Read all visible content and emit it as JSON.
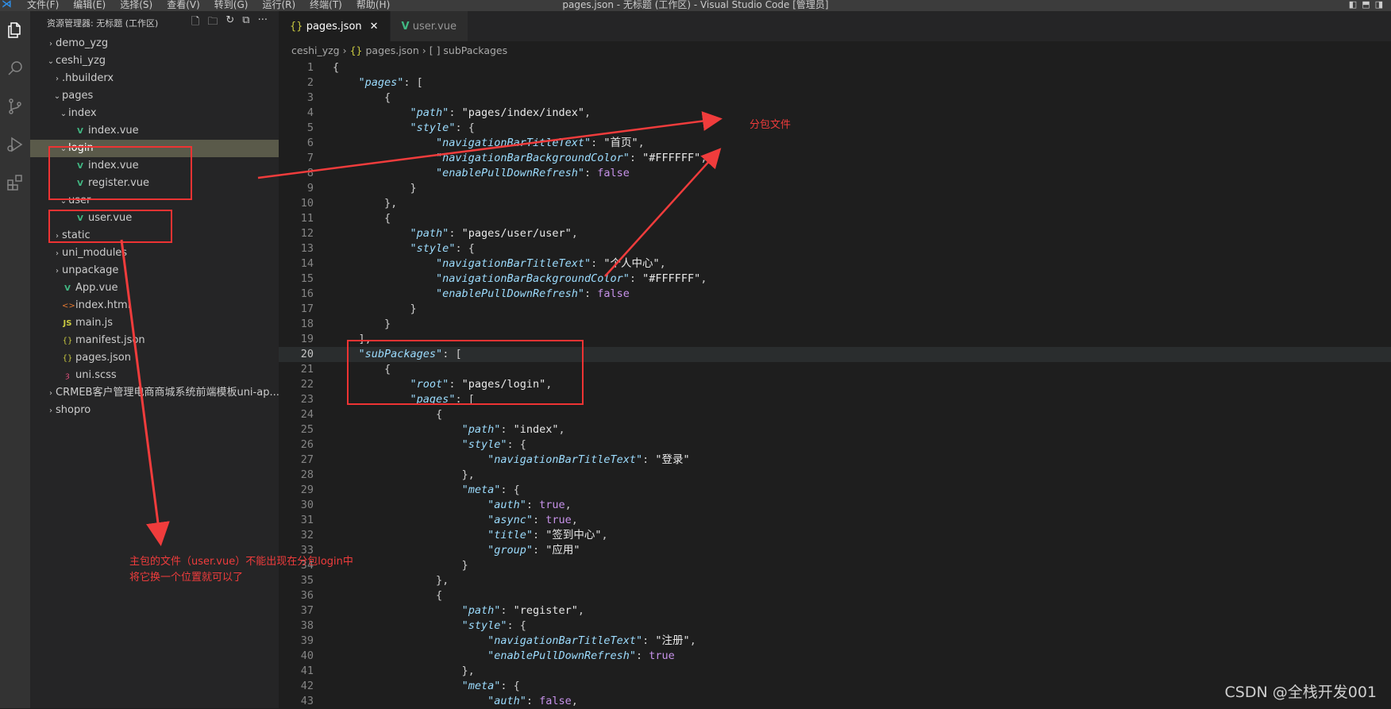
{
  "titlebar": {
    "menus": [
      "文件(F)",
      "编辑(E)",
      "选择(S)",
      "查看(V)",
      "转到(G)",
      "运行(R)",
      "终端(T)",
      "帮助(H)"
    ],
    "window_title": "pages.json - 无标题 (工作区) - Visual Studio Code [管理员]"
  },
  "sidebar": {
    "title": "资源管理器: 无标题 (工作区)",
    "tree": [
      {
        "label": "demo_yzg",
        "depth": 0,
        "chev": "›",
        "icon": ""
      },
      {
        "label": "ceshi_yzg",
        "depth": 0,
        "chev": "⌄",
        "icon": ""
      },
      {
        "label": ".hbuilderx",
        "depth": 1,
        "chev": "›",
        "icon": ""
      },
      {
        "label": "pages",
        "depth": 1,
        "chev": "⌄",
        "icon": ""
      },
      {
        "label": "index",
        "depth": 2,
        "chev": "⌄",
        "icon": ""
      },
      {
        "label": "index.vue",
        "depth": 3,
        "chev": "",
        "icon": "vue"
      },
      {
        "label": "login",
        "depth": 2,
        "chev": "⌄",
        "icon": "",
        "selected": true
      },
      {
        "label": "index.vue",
        "depth": 3,
        "chev": "",
        "icon": "vue"
      },
      {
        "label": "register.vue",
        "depth": 3,
        "chev": "",
        "icon": "vue"
      },
      {
        "label": "user",
        "depth": 2,
        "chev": "⌄",
        "icon": ""
      },
      {
        "label": "user.vue",
        "depth": 3,
        "chev": "",
        "icon": "vue"
      },
      {
        "label": "static",
        "depth": 1,
        "chev": "›",
        "icon": ""
      },
      {
        "label": "uni_modules",
        "depth": 1,
        "chev": "›",
        "icon": ""
      },
      {
        "label": "unpackage",
        "depth": 1,
        "chev": "›",
        "icon": ""
      },
      {
        "label": "App.vue",
        "depth": 1,
        "chev": "",
        "icon": "vue"
      },
      {
        "label": "index.html",
        "depth": 1,
        "chev": "",
        "icon": "html"
      },
      {
        "label": "main.js",
        "depth": 1,
        "chev": "",
        "icon": "js"
      },
      {
        "label": "manifest.json",
        "depth": 1,
        "chev": "",
        "icon": "json"
      },
      {
        "label": "pages.json",
        "depth": 1,
        "chev": "",
        "icon": "json"
      },
      {
        "label": "uni.scss",
        "depth": 1,
        "chev": "",
        "icon": "scss"
      },
      {
        "label": "CRMEB客户管理电商商城系统前端模板uni-ap...",
        "depth": 0,
        "chev": "›",
        "icon": ""
      },
      {
        "label": "shopro",
        "depth": 0,
        "chev": "›",
        "icon": ""
      }
    ]
  },
  "tabs": [
    {
      "label": "pages.json",
      "icon": "{}",
      "active": true,
      "close": "✕"
    },
    {
      "label": "user.vue",
      "icon": "V",
      "active": false
    }
  ],
  "breadcrumb": {
    "folder": "ceshi_yzg",
    "file": "pages.json",
    "symbol": "[ ] subPackages",
    "sep": "›"
  },
  "code_lines": [
    "{",
    "    \"pages\": [",
    "        {",
    "            \"path\": \"pages/index/index\",",
    "            \"style\": {",
    "                \"navigationBarTitleText\": \"首页\",",
    "                \"navigationBarBackgroundColor\": \"#FFFFFF\",",
    "                \"enablePullDownRefresh\": false",
    "            }",
    "        },",
    "        {",
    "            \"path\": \"pages/user/user\",",
    "            \"style\": {",
    "                \"navigationBarTitleText\": \"个人中心\",",
    "                \"navigationBarBackgroundColor\": \"#FFFFFF\",",
    "                \"enablePullDownRefresh\": false",
    "            }",
    "        }",
    "    ],",
    "    \"subPackages\": [",
    "        {",
    "            \"root\": \"pages/login\",",
    "            \"pages\": [",
    "                {",
    "                    \"path\": \"index\",",
    "                    \"style\": {",
    "                        \"navigationBarTitleText\": \"登录\"",
    "                    },",
    "                    \"meta\": {",
    "                        \"auth\": true,",
    "                        \"async\": true,",
    "                        \"title\": \"签到中心\",",
    "                        \"group\": \"应用\"",
    "                    }",
    "                },",
    "                {",
    "                    \"path\": \"register\",",
    "                    \"style\": {",
    "                        \"navigationBarTitleText\": \"注册\",",
    "                        \"enablePullDownRefresh\": true",
    "                    },",
    "                    \"meta\": {",
    "                        \"auth\": false,"
  ],
  "current_line": 20,
  "annotations": {
    "subpackage_label": "分包文件",
    "note_line1": "主包的文件（user.vue）不能出现在分包login中",
    "note_line2": "将它换一个位置就可以了"
  },
  "watermark": "CSDN @全栈开发001"
}
